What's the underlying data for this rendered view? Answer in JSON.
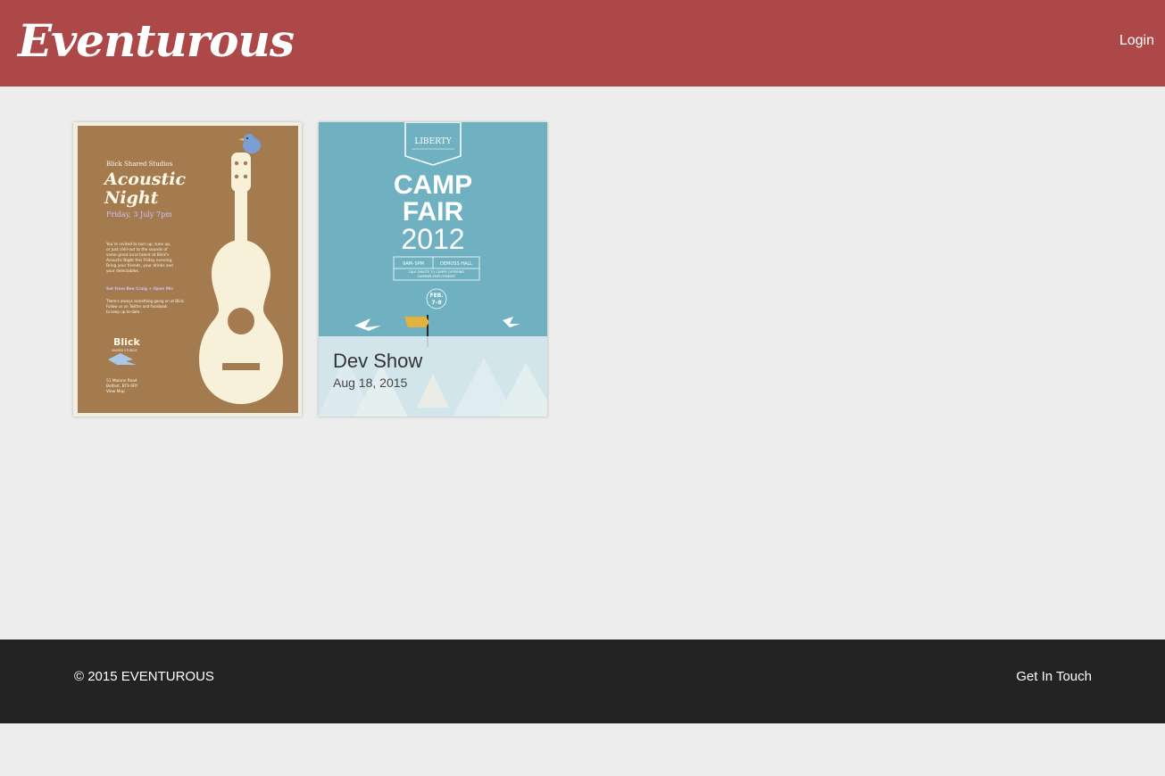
{
  "header": {
    "brand": "Eventurous",
    "login_label": "Login",
    "bg_color": "#ad4848"
  },
  "events": [
    {
      "poster": {
        "venue": "Blick Shared Studios",
        "title_line1": "Acoustic",
        "title_line2": "Night",
        "date": "Friday, 3 July 7pm",
        "body_lines": [
          "You're invited to turn up, tune up,",
          "or just chill-out to the sounds of",
          "some great local talent at Blick's",
          "Acoustic Night this Friday evening.",
          "Bring your friends, your drinks and",
          "your delectables."
        ],
        "set_line": "Set from Ben Craig + Open Mic",
        "more_lines": [
          "There's always something going on at Blick.",
          "Follow us on Twitter and Facebook",
          "to keep up-to-date."
        ],
        "logo_text": "Blick",
        "logo_sub": "SHARED STUDIOS",
        "address1": "51 Malone Road",
        "address2": "Belfast, BT9 6RY",
        "map_link": "View Map"
      }
    },
    {
      "title": "Dev Show",
      "date": "Aug 18, 2015",
      "poster": {
        "badge": "LIBERTY",
        "line1": "CAMP",
        "line2": "FAIR",
        "year": "2012",
        "time": "9AM–5PM",
        "place": "DEMOSS HALL",
        "sub1": "TALK ONSITE TO CAMPS OFFERING",
        "sub2": "SUMMER EMPLOYMENT!",
        "feb": "FEB.",
        "days": "7–8"
      }
    }
  ],
  "footer": {
    "copyright": "© 2015 EVENTUROUS",
    "contact_label": "Get In Touch"
  }
}
